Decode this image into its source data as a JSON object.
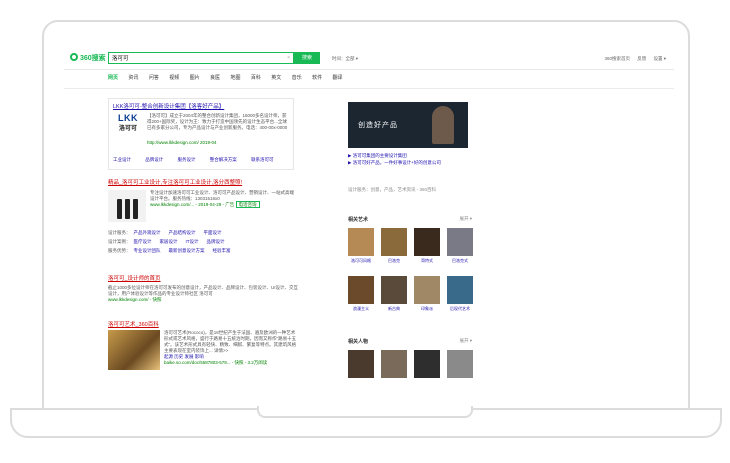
{
  "search": {
    "logo": "360搜索",
    "query": "洛可可",
    "button": "搜索",
    "time_filter": "时间：全部 ▾"
  },
  "header_right": [
    "360搜索首页",
    "反馈",
    "设置 ▾"
  ],
  "tabs": [
    "网页",
    "资讯",
    "问答",
    "视频",
    "图片",
    "良医",
    "地图",
    "百科",
    "英文",
    "音乐",
    "软件",
    "翻译"
  ],
  "result1": {
    "title": "LKK洛可可-整合创新设计集团【洛客好产品】",
    "logo_top": "LKK",
    "logo_bottom": "洛可可",
    "desc": "【洛可可】成立于2004年的整合创新设计集团，16000多名设计师，获得200+国际奖，设计为王：致力于打造中国领先的设计生态平台...全球已有多家分公司，专为产品设计与产业创新服务。电话：400-00x-0000",
    "url": "http://www.lkkdesign.com/ 2019-04",
    "buttons": [
      "工业设计",
      "品牌设计",
      "服务设计",
      "整合解决方案",
      "联系洛可可"
    ]
  },
  "result2": {
    "title": "精品_洛可可工业设计,专注洛可可工业设计,洛分西整照!",
    "desc": "专注设计加速洛可可工业设计、洛可可产品设计、营销设计、一站式高端设计平台。服务热线：13031518x0",
    "url": "www.lkkdesign.com/... - 2019-04-29 - 广告",
    "call": "电话咨询",
    "rows": [
      {
        "label": "设计服务：",
        "items": [
          "产品外观设计",
          "产品结构设计",
          "平面设计"
        ]
      },
      {
        "label": "设计案例：",
        "items": [
          "医疗设计",
          "家居设计",
          "IT设计",
          "品牌设计"
        ]
      },
      {
        "label": "服务优势：",
        "items": [
          "专业设计团队",
          "最新创意设计方案",
          "经验丰富"
        ]
      }
    ]
  },
  "result3": {
    "title": "洛可可_设计师的首页",
    "desc": "截止1000多位设计师在洛可可发布的创意设计，产品设计、品牌设计、包装设计、UI设计、交互设计，用户体验设计等作品的专业设计师社区 洛可可",
    "url": "www.lkkdesign.com/ - 快照"
  },
  "result4": {
    "title": "洛可可艺术_360百科",
    "desc": "洛可可艺术(Rococo)，是18世纪产生于法国、遍及欧洲的一种艺术形式或艺术风格，盛行于路易十五统治时期，因而又称作\"路易十五式\"。该艺术形式具有轻快、精致、细腻、繁复等特点。其建筑风格主要表现在室内装饰上... 详情>>",
    "links": [
      "起源",
      "历史",
      "发展",
      "影响"
    ],
    "url": "baike.so.com/doc/5587803-579... - 快照 - 3.2万阅读"
  },
  "right": {
    "banner_text": "创造好产品",
    "links": [
      "▶ 洛可可集团的主要设计集团",
      "▶ 洛可可好产品，一件好事设计+好的创意公司"
    ],
    "info": "设计服务：创意，产品，艺术资讯 - 360百科",
    "related1_title": "相关艺术",
    "related1_more": "展开 ▾",
    "related1": [
      "洛可可风格",
      "巴洛克",
      "哥特式",
      "巴洛克式",
      "浪漫主义",
      "新古典",
      "印象派",
      "后现代艺术"
    ],
    "related2_title": "相关人物",
    "related2_more": "展开 ▾"
  }
}
